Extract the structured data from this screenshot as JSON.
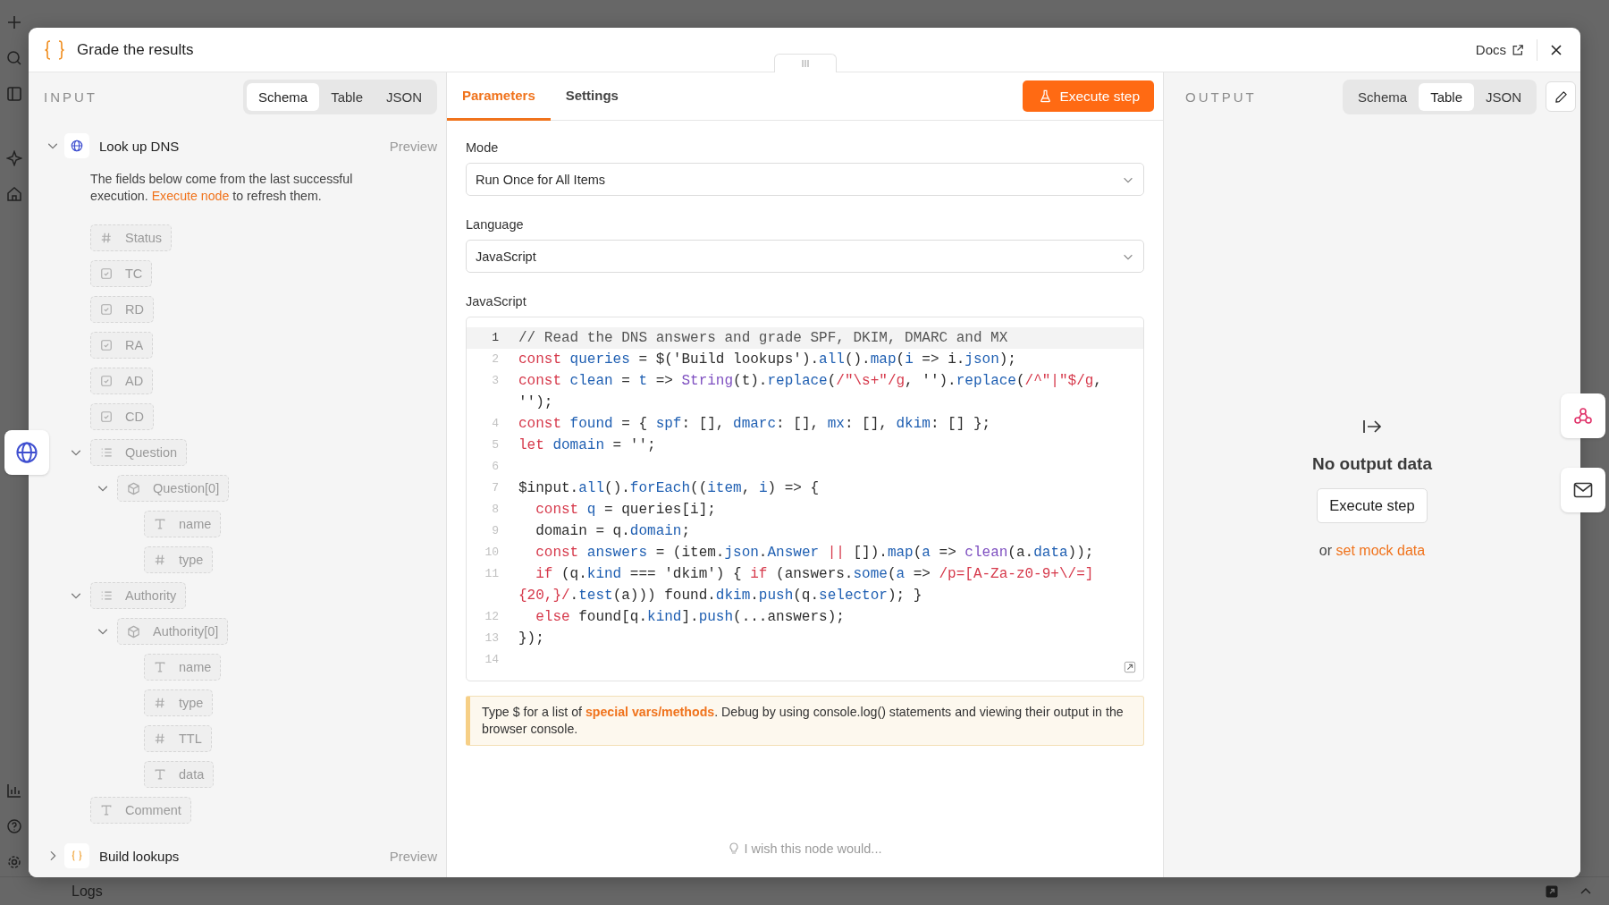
{
  "bottom_bar": {
    "label": "Logs"
  },
  "window": {
    "title": "Grade the results",
    "docs_link": "Docs"
  },
  "input_panel": {
    "heading": "INPUT",
    "view_tabs": [
      {
        "label": "Schema",
        "selected": true
      },
      {
        "label": "Table",
        "selected": false
      },
      {
        "label": "JSON",
        "selected": false
      }
    ],
    "nodes": [
      {
        "name": "Look up DNS",
        "kind": "request",
        "expanded": true,
        "preview": "Preview",
        "notice": {
          "before": "The fields below come from the last successful execution.",
          "link": "Execute node",
          "after": "to refresh them."
        },
        "fields": [
          {
            "kind": "number",
            "label": "Status"
          },
          {
            "kind": "boolean",
            "label": "TC"
          },
          {
            "kind": "boolean",
            "label": "RD"
          },
          {
            "kind": "boolean",
            "label": "RA"
          },
          {
            "kind": "boolean",
            "label": "AD"
          },
          {
            "kind": "boolean",
            "label": "CD"
          },
          {
            "kind": "array",
            "label": "Question",
            "expanded": true,
            "children": [
              {
                "kind": "object",
                "label": "Question[0]",
                "expanded": true,
                "children": [
                  {
                    "kind": "string",
                    "label": "name"
                  },
                  {
                    "kind": "number",
                    "label": "type"
                  }
                ]
              }
            ]
          },
          {
            "kind": "array",
            "label": "Authority",
            "expanded": true,
            "children": [
              {
                "kind": "object",
                "label": "Authority[0]",
                "expanded": true,
                "children": [
                  {
                    "kind": "string",
                    "label": "name"
                  },
                  {
                    "kind": "number",
                    "label": "type"
                  },
                  {
                    "kind": "number",
                    "label": "TTL"
                  },
                  {
                    "kind": "string",
                    "label": "data"
                  }
                ]
              }
            ]
          },
          {
            "kind": "string",
            "label": "Comment"
          }
        ]
      },
      {
        "name": "Build lookups",
        "kind": "code",
        "expanded": false,
        "preview": "Preview"
      }
    ]
  },
  "parameters_panel": {
    "tabs": [
      {
        "label": "Parameters",
        "selected": true
      },
      {
        "label": "Settings",
        "selected": false
      }
    ],
    "execute_button": "Execute step",
    "fields": [
      {
        "label": "Mode",
        "value": "Run Once for All Items"
      },
      {
        "label": "Language",
        "value": "JavaScript"
      }
    ],
    "code_label": "JavaScript",
    "code_lines": [
      {
        "number": "1",
        "active": true,
        "tokens": [
          {
            "kind": "comment",
            "text": "// Read the DNS answers and grade SPF, DKIM, DMARC and MX"
          }
        ]
      },
      {
        "number": "2",
        "active": false,
        "tokens": [
          {
            "kind": "kw",
            "text": "const "
          },
          {
            "kind": "name",
            "text": "queries"
          },
          {
            "kind": "plain",
            "text": " = $("
          },
          {
            "kind": "str",
            "text": "'Build lookups'"
          },
          {
            "kind": "plain",
            "text": ")."
          },
          {
            "kind": "name",
            "text": "all"
          },
          {
            "kind": "plain",
            "text": "()."
          },
          {
            "kind": "name",
            "text": "map"
          },
          {
            "kind": "plain",
            "text": "("
          },
          {
            "kind": "name",
            "text": "i"
          },
          {
            "kind": "plain",
            "text": " => i."
          },
          {
            "kind": "name",
            "text": "json"
          },
          {
            "kind": "plain",
            "text": ");"
          }
        ]
      },
      {
        "number": "3",
        "active": false,
        "tokens": [
          {
            "kind": "kw",
            "text": "const "
          },
          {
            "kind": "name",
            "text": "clean"
          },
          {
            "kind": "plain",
            "text": " = "
          },
          {
            "kind": "name",
            "text": "t"
          },
          {
            "kind": "plain",
            "text": " => "
          },
          {
            "kind": "fn",
            "text": "String"
          },
          {
            "kind": "plain",
            "text": "(t)."
          },
          {
            "kind": "name",
            "text": "replace"
          },
          {
            "kind": "plain",
            "text": "("
          },
          {
            "kind": "regex",
            "text": "/\"\\s+\"/g"
          },
          {
            "kind": "plain",
            "text": ", '')."
          },
          {
            "kind": "name",
            "text": "replace"
          },
          {
            "kind": "plain",
            "text": "("
          },
          {
            "kind": "regex",
            "text": "/^\"|\"$/g"
          },
          {
            "kind": "plain",
            "text": ", '');"
          }
        ]
      },
      {
        "number": "4",
        "active": false,
        "tokens": [
          {
            "kind": "kw",
            "text": "const "
          },
          {
            "kind": "name",
            "text": "found"
          },
          {
            "kind": "plain",
            "text": " = { "
          },
          {
            "kind": "name",
            "text": "spf"
          },
          {
            "kind": "plain",
            "text": ": [], "
          },
          {
            "kind": "name",
            "text": "dmarc"
          },
          {
            "kind": "plain",
            "text": ": [], "
          },
          {
            "kind": "name",
            "text": "mx"
          },
          {
            "kind": "plain",
            "text": ": [], "
          },
          {
            "kind": "name",
            "text": "dkim"
          },
          {
            "kind": "plain",
            "text": ": [] };"
          }
        ]
      },
      {
        "number": "5",
        "active": false,
        "tokens": [
          {
            "kind": "kw",
            "text": "let "
          },
          {
            "kind": "name",
            "text": "domain"
          },
          {
            "kind": "plain",
            "text": " = '';"
          }
        ]
      },
      {
        "number": "6",
        "active": false
      },
      {
        "number": "7",
        "active": false,
        "tokens": [
          {
            "kind": "plain",
            "text": "$input."
          },
          {
            "kind": "name",
            "text": "all"
          },
          {
            "kind": "plain",
            "text": "()."
          },
          {
            "kind": "name",
            "text": "forEach"
          },
          {
            "kind": "plain",
            "text": "(("
          },
          {
            "kind": "name",
            "text": "item"
          },
          {
            "kind": "plain",
            "text": ", "
          },
          {
            "kind": "name",
            "text": "i"
          },
          {
            "kind": "plain",
            "text": ") => {"
          }
        ]
      },
      {
        "number": "8",
        "active": false,
        "tokens": [
          {
            "kind": "kw",
            "text": "  const "
          },
          {
            "kind": "name",
            "text": "q"
          },
          {
            "kind": "plain",
            "text": " = queries[i];"
          }
        ]
      },
      {
        "number": "9",
        "active": false,
        "tokens": [
          {
            "kind": "plain",
            "text": "  domain = q."
          },
          {
            "kind": "name",
            "text": "domain"
          },
          {
            "kind": "plain",
            "text": ";"
          }
        ]
      },
      {
        "number": "10",
        "active": false,
        "tokens": [
          {
            "kind": "kw",
            "text": "  const "
          },
          {
            "kind": "name",
            "text": "answers"
          },
          {
            "kind": "plain",
            "text": " = (item."
          },
          {
            "kind": "name",
            "text": "json"
          },
          {
            "kind": "plain",
            "text": "."
          },
          {
            "kind": "name",
            "text": "Answer"
          },
          {
            "kind": "kw",
            "text": " ||"
          },
          {
            "kind": "plain",
            "text": " [])."
          },
          {
            "kind": "name",
            "text": "map"
          },
          {
            "kind": "plain",
            "text": "("
          },
          {
            "kind": "name",
            "text": "a"
          },
          {
            "kind": "plain",
            "text": " => "
          },
          {
            "kind": "fn",
            "text": "clean"
          },
          {
            "kind": "plain",
            "text": "(a."
          },
          {
            "kind": "name",
            "text": "data"
          },
          {
            "kind": "plain",
            "text": "));"
          }
        ]
      },
      {
        "number": "11",
        "active": false,
        "tokens": [
          {
            "kind": "kw",
            "text": "  if"
          },
          {
            "kind": "plain",
            "text": " (q."
          },
          {
            "kind": "name",
            "text": "kind"
          },
          {
            "kind": "plain",
            "text": " === 'dkim') { "
          },
          {
            "kind": "kw",
            "text": "if"
          },
          {
            "kind": "plain",
            "text": " (answers."
          },
          {
            "kind": "name",
            "text": "some"
          },
          {
            "kind": "plain",
            "text": "("
          },
          {
            "kind": "name",
            "text": "a"
          },
          {
            "kind": "plain",
            "text": " => "
          },
          {
            "kind": "regex",
            "text": "/p=[A-Za-z0-9+\\/=]"
          },
          {
            "kind": "regex",
            "text": "{20,}/"
          },
          {
            "kind": "plain",
            "text": "."
          },
          {
            "kind": "name",
            "text": "test"
          },
          {
            "kind": "plain",
            "text": "(a))) found."
          },
          {
            "kind": "name",
            "text": "dkim"
          },
          {
            "kind": "plain",
            "text": "."
          },
          {
            "kind": "name",
            "text": "push"
          },
          {
            "kind": "plain",
            "text": "(q."
          },
          {
            "kind": "name",
            "text": "selector"
          },
          {
            "kind": "plain",
            "text": "); }"
          }
        ]
      },
      {
        "number": "12",
        "active": false,
        "tokens": [
          {
            "kind": "kw",
            "text": "  else"
          },
          {
            "kind": "plain",
            "text": " found[q."
          },
          {
            "kind": "name",
            "text": "kind"
          },
          {
            "kind": "plain",
            "text": "]."
          },
          {
            "kind": "name",
            "text": "push"
          },
          {
            "kind": "plain",
            "text": "(...answers);"
          }
        ]
      },
      {
        "number": "13",
        "active": false,
        "tokens": [
          {
            "kind": "plain",
            "text": "});"
          }
        ]
      },
      {
        "number": "14",
        "active": false
      }
    ],
    "hint": {
      "before": "Type $ for a list of",
      "link": "special vars/methods",
      "after": ". Debug by using console.log() statements and viewing their output in the browser console."
    },
    "feedback": "I wish this node would..."
  },
  "output_panel": {
    "heading": "OUTPUT",
    "view_tabs": [
      {
        "label": "Schema",
        "selected": false
      },
      {
        "label": "Table",
        "selected": true
      },
      {
        "label": "JSON",
        "selected": false
      }
    ],
    "empty_title": "No output data",
    "execute_button": "Execute step",
    "mock_prefix": "or",
    "mock_link": "set mock data"
  }
}
